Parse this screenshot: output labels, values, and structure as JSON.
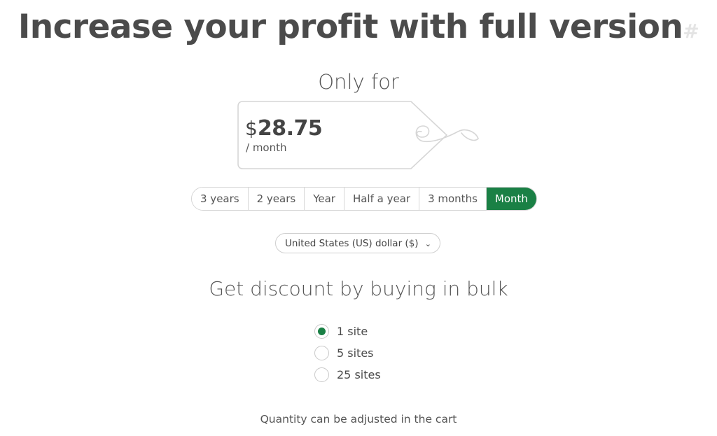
{
  "heading": {
    "title": "Increase your profit with full version",
    "anchor": "#"
  },
  "pricing": {
    "only_for": "Only for",
    "currency_symbol": "$",
    "amount": "28.75",
    "per": "/ month"
  },
  "periods": {
    "items": [
      "3 years",
      "2 years",
      "Year",
      "Half a year",
      "3 months",
      "Month"
    ],
    "selected": "Month"
  },
  "currency_select": {
    "value": "United States (US) dollar ($)"
  },
  "bulk": {
    "title": "Get discount by buying in bulk",
    "options": [
      "1 site",
      "5 sites",
      "25 sites"
    ],
    "selected": "1 site"
  },
  "note": "Quantity can be adjusted in the cart",
  "colors": {
    "accent": "#1a8045",
    "text": "#4b4b4b",
    "border": "#d4d4d4"
  },
  "icons": {
    "price_tag": "price-tag-outline",
    "dropdown": "chevron-down-icon"
  }
}
